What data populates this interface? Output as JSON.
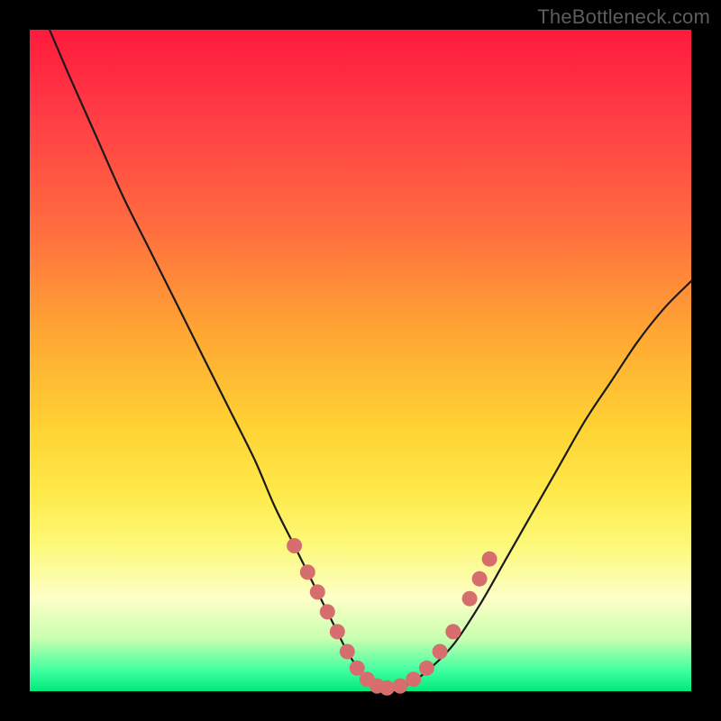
{
  "watermark": "TheBottleneck.com",
  "colors": {
    "frame": "#000000",
    "curve_stroke": "#1a1a1a",
    "marker_fill": "#d76e6e",
    "marker_stroke": "#c95f5f"
  },
  "chart_data": {
    "type": "line",
    "title": "",
    "xlabel": "",
    "ylabel": "",
    "xlim": [
      0,
      100
    ],
    "ylim": [
      0,
      100
    ],
    "series": [
      {
        "name": "bottleneck-curve",
        "x": [
          3,
          6,
          10,
          14,
          18,
          22,
          26,
          30,
          34,
          37,
          40,
          43,
          46,
          48,
          50,
          52,
          54,
          57,
          60,
          64,
          68,
          72,
          76,
          80,
          84,
          88,
          92,
          96,
          100
        ],
        "y": [
          100,
          93,
          84,
          75,
          67,
          59,
          51,
          43,
          35,
          28,
          22,
          16,
          10,
          6,
          3,
          1,
          0.5,
          1,
          3,
          7,
          13,
          20,
          27,
          34,
          41,
          47,
          53,
          58,
          62
        ]
      }
    ],
    "markers": [
      {
        "x": 40,
        "y": 22
      },
      {
        "x": 42,
        "y": 18
      },
      {
        "x": 43.5,
        "y": 15
      },
      {
        "x": 45,
        "y": 12
      },
      {
        "x": 46.5,
        "y": 9
      },
      {
        "x": 48,
        "y": 6
      },
      {
        "x": 49.5,
        "y": 3.5
      },
      {
        "x": 51,
        "y": 1.8
      },
      {
        "x": 52.5,
        "y": 0.8
      },
      {
        "x": 54,
        "y": 0.5
      },
      {
        "x": 56,
        "y": 0.8
      },
      {
        "x": 58,
        "y": 1.8
      },
      {
        "x": 60,
        "y": 3.5
      },
      {
        "x": 62,
        "y": 6
      },
      {
        "x": 64,
        "y": 9
      },
      {
        "x": 66.5,
        "y": 14
      },
      {
        "x": 68,
        "y": 17
      },
      {
        "x": 69.5,
        "y": 20
      }
    ]
  }
}
